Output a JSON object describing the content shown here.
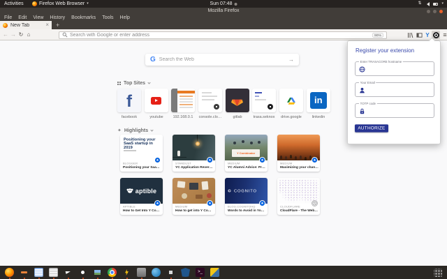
{
  "desktop": {
    "top_bar": {
      "activities": "Activities",
      "app_menu": "Firefox Web Browser",
      "clock": "Sun 07:48"
    },
    "dock_icons": [
      "firefox",
      "file-manager",
      "text-editor",
      "document-viewer",
      "telegram",
      "ubuntu-software",
      "image-viewer",
      "chrome",
      "power-manager",
      "virtualbox",
      "web-app",
      "utility-app",
      "network-shield",
      "terminal",
      "password-keys"
    ]
  },
  "window": {
    "title": "Mozilla Firefox",
    "menus": [
      "File",
      "Edit",
      "View",
      "History",
      "Bookmarks",
      "Tools",
      "Help"
    ],
    "tab_title": "New Tab",
    "url_placeholder": "Search with Google or enter address",
    "zoom_level": "90%"
  },
  "newtab": {
    "search_placeholder": "Search the Web",
    "top_sites_label": "Top Sites",
    "highlights_label": "Highlights",
    "top_sites": [
      {
        "label": "facebook",
        "logo_text": "f"
      },
      {
        "label": "youtube"
      },
      {
        "label": "192.168.0.1"
      },
      {
        "label": "console.clo…"
      },
      {
        "label": "gitlab"
      },
      {
        "label": "trasa.seknox"
      },
      {
        "label": "drive.google"
      },
      {
        "label": "linkedin",
        "logo_text": "in"
      }
    ],
    "highlights": [
      {
        "source": "BLOGGER",
        "title": "Positioning your SaaS startup i…",
        "badge": "bookmark-star",
        "art_text": "Positioning your SaaS startup in 2019"
      },
      {
        "source": "STANDUST",
        "title": "YC Application Reverse Engine…",
        "badge": "bookmark-star"
      },
      {
        "source": "MEDIUM",
        "title": "YC Alumni Advice: Preparing f…",
        "badge": "bookmark-star",
        "art_text": "Y Combinator"
      },
      {
        "source": "MEDIUM",
        "title": "Maximizing your chances of ge…",
        "badge": "bookmark-star"
      },
      {
        "source": "APTIBLE",
        "title": "How to Get Into Y Combinator …",
        "badge": "bookmark-star",
        "art_text": "aptible"
      },
      {
        "source": "MEDIUM",
        "title": "How to get into Y Combinator …",
        "badge": "bookmark-star"
      },
      {
        "source": "BLOG.COGNITOHQ",
        "title": "Words to Avoid in Your YC Ap…",
        "badge": "bookmark-star",
        "art_text": "COGNITO"
      },
      {
        "source": "CLOUDFLARE",
        "title": "CloudFlare - The Web Perform…",
        "badge": "history-clock"
      }
    ]
  },
  "popup": {
    "title": "Register your extension",
    "fields": [
      {
        "label": "Enter TRASACORE hostname",
        "icon": "globe"
      },
      {
        "label": "Your Email",
        "icon": "person"
      },
      {
        "label": "TOTP code",
        "icon": "lock"
      }
    ],
    "authorize_label": "AUTHORIZE"
  },
  "colors": {
    "accent_indigo": "#283593",
    "popup_title_indigo": "#3949ab",
    "star_badge_blue": "#0060df",
    "facebook_blue": "#3b5998",
    "youtube_red": "#e62117",
    "linkedin_blue": "#0a66c2",
    "gitlab_orange": "#fc6d26",
    "ubuntu_orange": "#e95420"
  }
}
